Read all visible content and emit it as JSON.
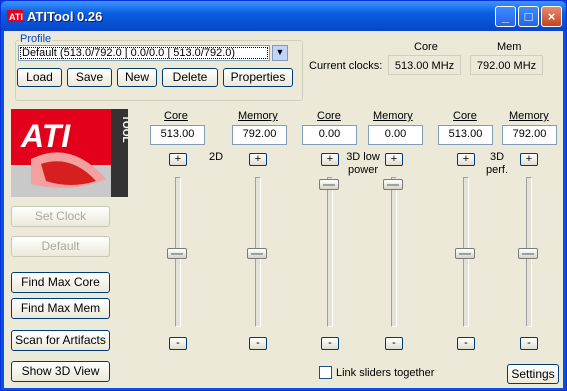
{
  "window": {
    "title": "ATITool 0.26",
    "min_icon": "minimize-icon",
    "max_icon": "maximize-icon",
    "close_icon": "close-icon"
  },
  "profile": {
    "group_label": "Profile",
    "selected": "Default (513.0/792.0 | 0.0/0.0 | 513.0/792.0)",
    "buttons": [
      "Load",
      "Save",
      "New",
      "Delete",
      "Properties"
    ]
  },
  "current_clocks": {
    "label": "Current clocks:",
    "core_header": "Core",
    "mem_header": "Mem",
    "core_value": "513.00 MHz",
    "mem_value": "792.00 MHz"
  },
  "logo": {
    "text": "ATI",
    "subtext": "TOOL"
  },
  "left_buttons": {
    "set_clock": "Set Clock",
    "default": "Default",
    "find_max_core": "Find Max Core",
    "find_max_mem": "Find Max Mem",
    "scan_artifacts": "Scan for Artifacts",
    "show_3d": "Show 3D View"
  },
  "modes": [
    {
      "label": "2D",
      "core_header": "Core",
      "memory_header": "Memory",
      "core_value": "513.00",
      "memory_value": "792.00",
      "core_level": 0.5,
      "memory_level": 0.5
    },
    {
      "label": "3D low power",
      "core_header": "Core",
      "memory_header": "Memory",
      "core_value": "0.00",
      "memory_value": "0.00",
      "core_level": 0.0,
      "memory_level": 0.0
    },
    {
      "label": "3D perf.",
      "core_header": "Core",
      "memory_header": "Memory",
      "core_value": "513.00",
      "memory_value": "792.00",
      "core_level": 0.5,
      "memory_level": 0.5
    }
  ],
  "plus": "+",
  "minus": "-",
  "link_sliders": {
    "label": "Link sliders together",
    "checked": false
  },
  "settings_button": "Settings",
  "colors": {
    "titlebar": "#0a5fe0",
    "accent_red": "#e3001b",
    "group_label": "#0046d5"
  }
}
